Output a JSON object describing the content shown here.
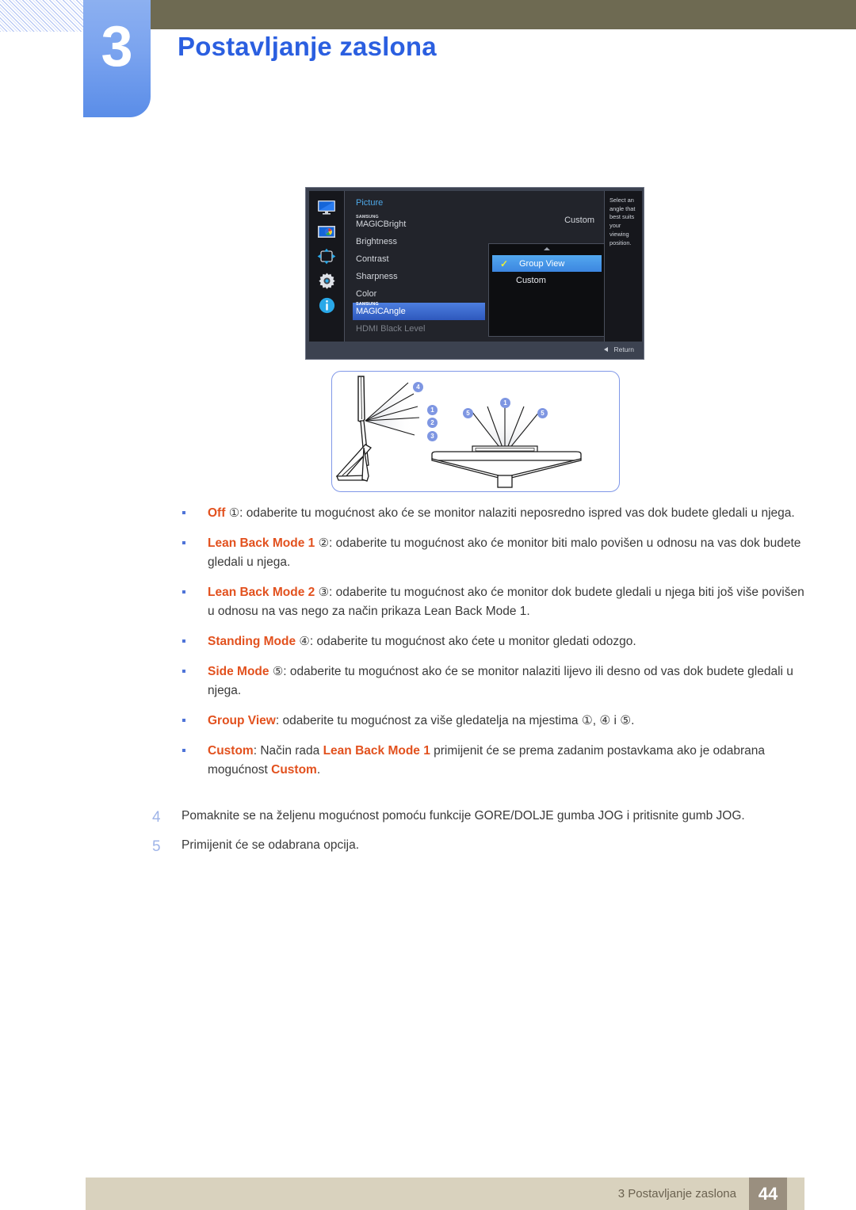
{
  "header": {
    "chapter_number": "3",
    "chapter_title": "Postavljanje zaslona"
  },
  "osd": {
    "menu_title": "Picture",
    "icons": [
      "monitor-icon",
      "picture-color-icon",
      "move-arrows-icon",
      "gear-icon",
      "info-icon"
    ],
    "items": [
      {
        "label_prefix": "SAMSUNG",
        "label_magic": "MAGIC",
        "label_suffix": "Bright",
        "value": "Custom",
        "state": "normal"
      },
      {
        "label": "Brightness",
        "state": "normal"
      },
      {
        "label": "Contrast",
        "state": "normal"
      },
      {
        "label": "Sharpness",
        "state": "normal"
      },
      {
        "label": "Color",
        "state": "normal"
      },
      {
        "label_prefix": "SAMSUNG",
        "label_magic": "MAGIC",
        "label_suffix": "Angle",
        "state": "selected"
      },
      {
        "label": "HDMI Black Level",
        "state": "disabled"
      }
    ],
    "popup": {
      "options": [
        {
          "label": "Group View",
          "checked": true
        },
        {
          "label": "Custom",
          "checked": false
        }
      ],
      "check_glyph": "✓",
      "scroll_up_glyph": "▲"
    },
    "help_text": "Select an angle that best suits your viewing position.",
    "return_label": "Return"
  },
  "diagram": {
    "side_view_badges": [
      "4",
      "1",
      "2",
      "3"
    ],
    "top_view_badges": [
      "5",
      "1",
      "5"
    ]
  },
  "bullets": [
    {
      "term": "Off",
      "circled": "①",
      "body": ": odaberite tu mogućnost ako će se monitor nalaziti neposredno ispred vas dok budete gledali u njega."
    },
    {
      "term": "Lean Back Mode 1",
      "circled": "②",
      "body": ": odaberite tu mogućnost ako će monitor biti malo povišen u odnosu na vas dok budete gledali u njega."
    },
    {
      "term": "Lean Back Mode 2",
      "circled": "③",
      "body": ": odaberite tu mogućnost ako će monitor dok budete gledali u njega biti još više povišen u odnosu na vas nego za način prikaza Lean Back Mode 1."
    },
    {
      "term": "Standing Mode",
      "circled": "④",
      "body": ": odaberite tu mogućnost ako ćete u monitor gledati odozgo."
    },
    {
      "term": "Side Mode",
      "circled": "⑤",
      "body": ": odaberite tu mogućnost ako će se monitor nalaziti lijevo ili desno od vas dok budete gledali u njega."
    },
    {
      "term": "Group View",
      "circled": "",
      "body": ": odaberite tu mogućnost za više gledatelja na mjestima ①, ④ i ⑤."
    },
    {
      "term": "Custom",
      "circled": "",
      "body": ": Način rada ",
      "term2": "Lean Back Mode 1",
      "body2": " primijenit će se prema zadanim postavkama ako je odabrana mogućnost ",
      "term3": "Custom",
      "body3": "."
    }
  ],
  "steps": [
    {
      "number": "4",
      "text": "Pomaknite se na željenu mogućnost pomoću funkcije GORE/DOLJE gumba JOG i pritisnite gumb JOG."
    },
    {
      "number": "5",
      "text": "Primijenit će se odabrana opcija."
    }
  ],
  "footer": {
    "section": "3 Postavljanje zaslona",
    "page_number": "44"
  },
  "colors": {
    "chapter_blue": "#5a8de8",
    "title_blue": "#2b5fe0",
    "olive": "#6e6a52",
    "term_orange": "#e2511e",
    "footer_beige": "#d9d2be",
    "page_box": "#9a8f7f",
    "badge_blue": "#7e96e2"
  }
}
